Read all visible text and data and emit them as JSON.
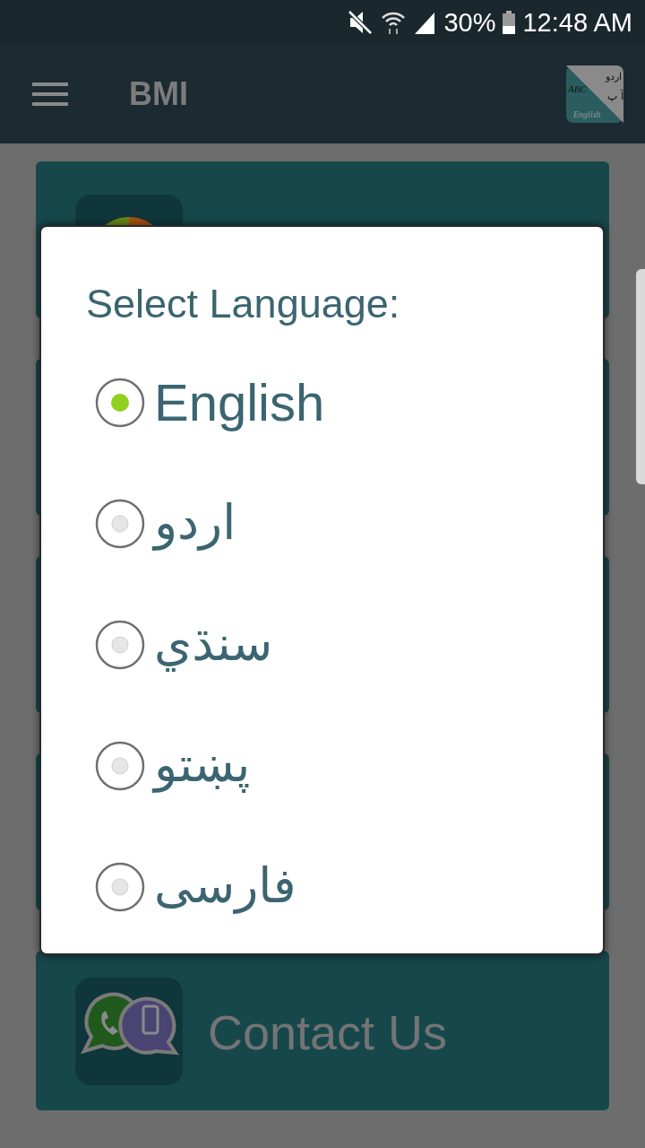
{
  "status_bar": {
    "battery": "30%",
    "time": "12:48 AM"
  },
  "app_bar": {
    "title": "BMI",
    "logo": {
      "latin": "ABC",
      "urdu": "اردو",
      "urdu_letters": "آ پ",
      "caption": "English"
    }
  },
  "cards": [
    {
      "kind": "bmi"
    },
    {
      "kind": "hidden"
    },
    {
      "kind": "hidden"
    },
    {
      "kind": "hidden"
    },
    {
      "kind": "contact",
      "title": "Contact Us"
    }
  ],
  "dialog": {
    "title": "Select Language:",
    "options": [
      {
        "label": "English",
        "selected": true
      },
      {
        "label": "اردو",
        "selected": false
      },
      {
        "label": "سنڌي",
        "selected": false
      },
      {
        "label": "پښتو",
        "selected": false
      },
      {
        "label": "فارسی",
        "selected": false
      }
    ]
  }
}
